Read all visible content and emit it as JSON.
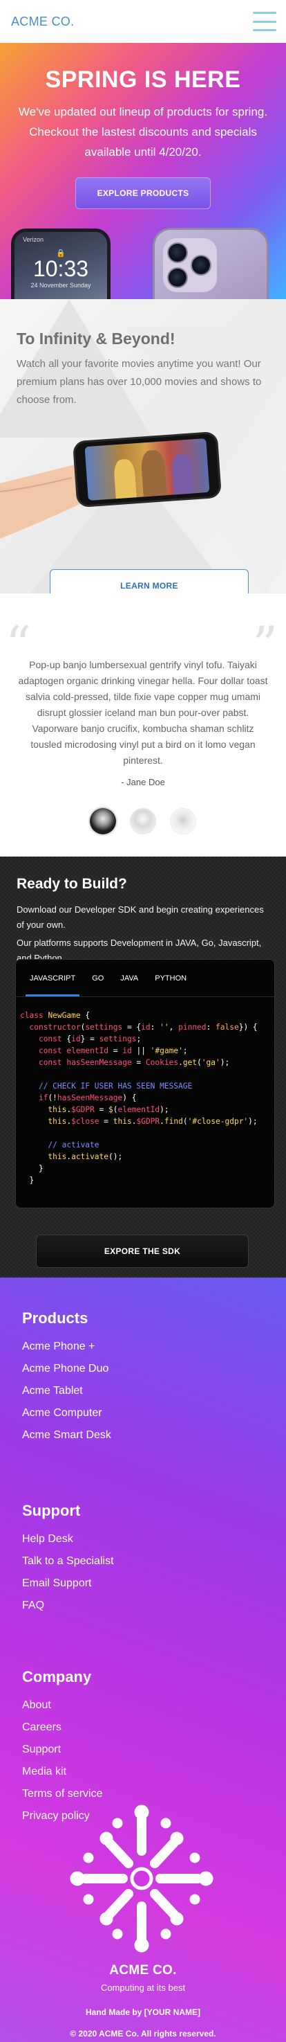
{
  "header": {
    "logo": "ACME CO."
  },
  "hero": {
    "title": "SPRING IS HERE",
    "text": "We've updated out lineup of products for spring. Checkout the lastest discounts and specials available until 4/20/20.",
    "button": "EXPLORE PRODUCTS",
    "phone_status": "Verizon",
    "phone_time": "10:33",
    "phone_date": "24 November Sunday"
  },
  "infinity": {
    "title": "To Infinity & Beyond!",
    "text": "Watch all your favorite movies anytime you want! Our premium plans has over 10,000 movies and shows to choose from.",
    "button": "LEARN MORE"
  },
  "testimonial": {
    "quote": "Pop-up banjo lumbersexual gentrify vinyl tofu. Taiyaki adaptogen organic drinking vinegar hella. Four dollar toast salvia cold-pressed, tilde fixie vape copper mug umami disrupt glossier iceland man bun pour-over pabst. Vaporware banjo crucifix, kombucha shaman schlitz tousled microdosing vinyl put a bird on it lomo vegan pinterest.",
    "author": "- Jane Doe"
  },
  "sdk": {
    "title": "Ready to Build?",
    "text1": "Download our Developer SDK and begin creating experiences of your own.",
    "text2": "Our platforms supports Development in JAVA, Go, Javascript, and Python.",
    "tabs": [
      "JAVASCRIPT",
      "GO",
      "JAVA",
      "PYTHON"
    ],
    "button": "EXPORE THE SDK",
    "colors": {
      "tab_underline": "#2f7fde"
    }
  },
  "footer": {
    "products_title": "Products",
    "products": [
      "Acme Phone +",
      "Acme Phone Duo",
      "Acme Tablet",
      "Acme Computer",
      "Acme Smart Desk"
    ],
    "support_title": "Support",
    "support": [
      "Help Desk",
      "Talk to a Specialist",
      "Email Support",
      "FAQ"
    ],
    "company_title": "Company",
    "company": [
      "About",
      "Careers",
      "Support",
      "Media kit",
      "Terms of service",
      "Privacy policy"
    ],
    "brand": "ACME CO.",
    "tagline": "Computing at its best",
    "made": "Hand Made by [YOUR NAME]",
    "copyright": "© 2020 ACME Co. All rights reserved."
  }
}
